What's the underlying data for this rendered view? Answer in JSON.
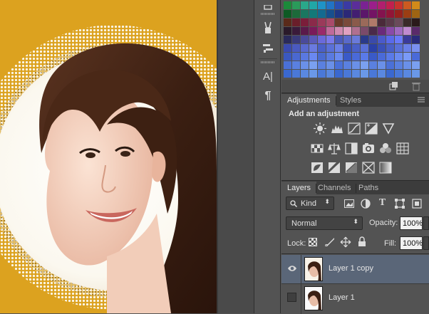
{
  "canvas": {
    "background": "#dca21f",
    "subject": "woman-portrait"
  },
  "tools": [
    {
      "name": "brush-preset-icon"
    },
    {
      "name": "clone-source-icon"
    },
    {
      "name": "character-icon",
      "glyph": "A|"
    },
    {
      "name": "paragraph-icon",
      "glyph": "¶"
    }
  ],
  "panels": {
    "adjustments": {
      "tabs": [
        "Adjustments",
        "Styles"
      ],
      "active_tab": "Adjustments",
      "heading": "Add an adjustment",
      "rows": [
        [
          "brightness-contrast-icon",
          "levels-icon",
          "curves-icon",
          "exposure-icon",
          "vibrance-icon"
        ],
        [
          "hue-saturation-icon",
          "color-balance-icon",
          "black-white-icon",
          "photo-filter-icon",
          "channel-mixer-icon",
          "color-lookup-icon"
        ],
        [
          "invert-icon",
          "posterize-icon",
          "threshold-icon",
          "selective-color-icon",
          "gradient-map-icon"
        ]
      ]
    },
    "layers": {
      "tabs": [
        "Layers",
        "Channels",
        "Paths"
      ],
      "active_tab": "Layers",
      "filter_kind": "Kind",
      "blend_mode": "Normal",
      "opacity_label": "Opacity:",
      "opacity_value": "100%",
      "lock_label": "Lock:",
      "fill_label": "Fill:",
      "fill_value": "100%",
      "items": [
        {
          "name": "Layer 1 copy",
          "visible": true,
          "selected": true
        },
        {
          "name": "Layer 1",
          "visible": false,
          "selected": false
        }
      ]
    }
  },
  "colors": {
    "panel_bg": "#535353",
    "tab_bar": "#3c3c3c",
    "selected_layer": "#5a6678",
    "canvas_orange": "#dca21f"
  }
}
